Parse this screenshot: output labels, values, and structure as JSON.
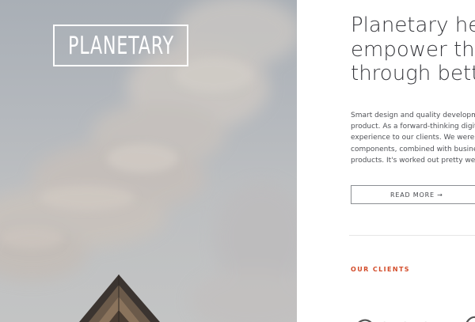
{
  "hero": {
    "logo_text": "PLANETARY"
  },
  "content": {
    "headline_lines": [
      "Planetary hel",
      "empower the",
      "through bette"
    ],
    "intro_lines": [
      "Smart design and quality developme",
      "product. As a forward-thinking digit",
      "experience to our clients. We were f",
      "components, combined with busine",
      "products. It's worked out pretty wel"
    ],
    "read_more_label": "READ MORE →",
    "clients_heading": "OUR CLIENTS"
  },
  "colors": {
    "accent": "#d34c2a",
    "headline": "#38393e",
    "body_text": "#505257",
    "sky": "#b4b8bd"
  }
}
